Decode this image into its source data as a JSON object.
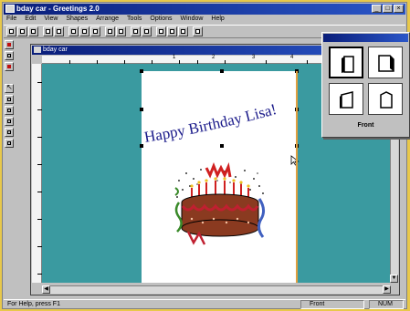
{
  "app": {
    "title": "bday car - Greetings 2.0",
    "window_buttons": [
      "_",
      "□",
      "×"
    ]
  },
  "menu": [
    "File",
    "Edit",
    "View",
    "Shapes",
    "Arrange",
    "Tools",
    "Options",
    "Window",
    "Help"
  ],
  "document": {
    "title": "bday car",
    "ruler_numbers": [
      "1",
      "2",
      "3",
      "4"
    ]
  },
  "card": {
    "headline": "Happy Birthday Lisa!"
  },
  "front_panel": {
    "label": "Front",
    "selected_index": 0
  },
  "status": {
    "help": "For Help, press F1",
    "page": "Front",
    "mode": "NUM"
  },
  "colors": {
    "title_bar": "#0a1e7a",
    "canvas": "#3a9aa0",
    "headline": "#1a1a8a",
    "cake": "#8a3a20",
    "frosting": "#c02030"
  }
}
